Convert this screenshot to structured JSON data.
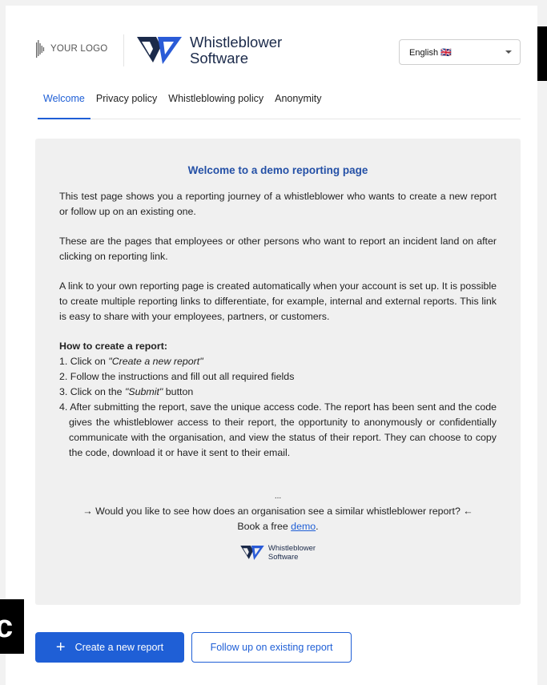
{
  "header": {
    "your_logo_text": "YOUR LOGO",
    "brand_line1": "Whistleblower",
    "brand_line2": "Software",
    "language": "English 🇬🇧"
  },
  "tabs": [
    {
      "label": "Welcome",
      "active": true
    },
    {
      "label": "Privacy policy",
      "active": false
    },
    {
      "label": "Whistleblowing policy",
      "active": false
    },
    {
      "label": "Anonymity",
      "active": false
    }
  ],
  "panel": {
    "title": "Welcome to a demo reporting page",
    "para1": "This test page shows you a reporting journey of a whistleblower who wants to create a new report or follow up on an existing one.",
    "para2": "These are the pages that employees or other persons who want to report an incident land on after clicking on reporting link.",
    "para3": "A link to your own reporting page is created automatically when your account is set up. It is possible to create multiple reporting links to differentiate, for example, internal and external reports. This link is easy to share with your employees, partners, or customers.",
    "howto_title": "How to create a report:",
    "step1_prefix": "1. Click on ",
    "step1_em": "\"Create a new report\"",
    "step2": "2. Follow the instructions and fill out all required fields",
    "step3_prefix": "3. Click on the ",
    "step3_em": "\"Submit\"",
    "step3_suffix": " button",
    "step4": "4. After submitting the report, save the unique access code. The report has been sent and the code gives the whistleblower access to their report, the opportunity to anonymously or confidentially communicate with the organisation, and view the status of their report. They can choose to copy the code, download it or have it sent to their email.",
    "dots": "...",
    "cta_line1": "→ Would you like to see how does an organisation see a similar whistleblower report? ←",
    "cta_prefix": "Book a free ",
    "cta_link": "demo",
    "cta_suffix": ".",
    "small_brand_line1": "Whistleblower",
    "small_brand_line2": "Software"
  },
  "actions": {
    "create_label": "Create a new report",
    "followup_label": "Follow up on existing report"
  },
  "overlay": {
    "left_char": "c"
  },
  "colors": {
    "accent": "#1f5fd6",
    "title_blue": "#2450a6",
    "panel_bg": "#f0f0f0",
    "brand_navy": "#1b2a4a"
  },
  "icons": {
    "your_logo": "bars-logo-icon",
    "brand": "ws-logo-icon",
    "dropdown": "chevron-down-icon",
    "create": "plus-icon"
  }
}
